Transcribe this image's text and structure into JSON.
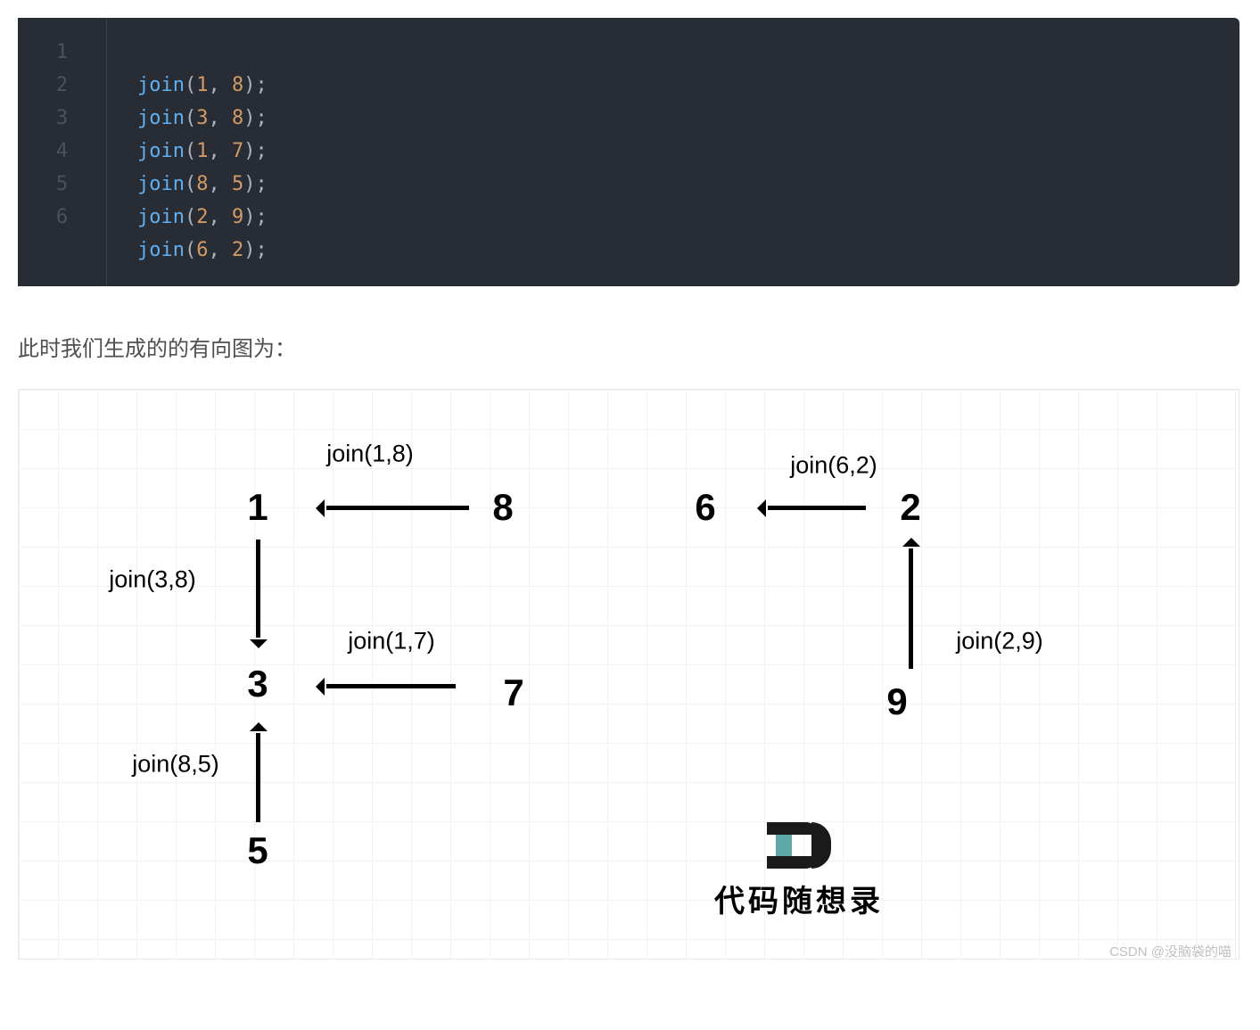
{
  "code": {
    "line_numbers": [
      "1",
      "2",
      "3",
      "4",
      "5",
      "6"
    ],
    "lines": [
      {
        "fn": "join",
        "a": "1",
        "b": "8"
      },
      {
        "fn": "join",
        "a": "3",
        "b": "8"
      },
      {
        "fn": "join",
        "a": "1",
        "b": "7"
      },
      {
        "fn": "join",
        "a": "8",
        "b": "5"
      },
      {
        "fn": "join",
        "a": "2",
        "b": "9"
      },
      {
        "fn": "join",
        "a": "6",
        "b": "2"
      }
    ]
  },
  "prose": "此时我们生成的的有向图为：",
  "diagram": {
    "nodes": {
      "n1": "1",
      "n8": "8",
      "n6": "6",
      "n2": "2",
      "n3": "3",
      "n7": "7",
      "n9": "9",
      "n5": "5"
    },
    "labels": {
      "l18": "join(1,8)",
      "l62": "join(6,2)",
      "l38": "join(3,8)",
      "l17": "join(1,7)",
      "l29": "join(2,9)",
      "l85": "join(8,5)"
    },
    "logo_text": "代码随想录",
    "watermark": "CSDN @没脑袋的喵"
  }
}
